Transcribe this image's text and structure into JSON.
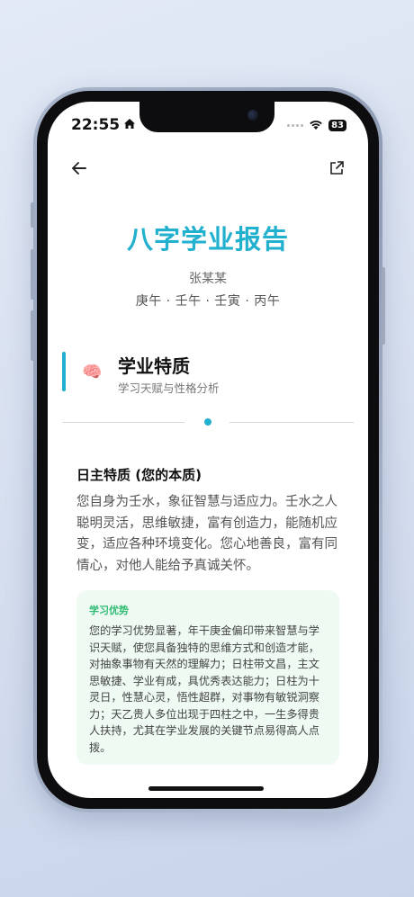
{
  "status": {
    "time": "22:55",
    "battery": "83"
  },
  "report": {
    "title": "八字学业报告",
    "name": "张某某",
    "pillars": "庚午 · 壬午 · 壬寅 · 丙午"
  },
  "section": {
    "title": "学业特质",
    "subtitle": "学习天赋与性格分析",
    "icon": "brain-icon"
  },
  "day_master": {
    "heading": "日主特质 (您的本质)",
    "text": "您自身为壬水，象征智慧与适应力。壬水之人聪明灵活，思维敏捷，富有创造力，能随机应变，适应各种环境变化。您心地善良，富有同情心，对他人能给予真诚关怀。"
  },
  "advantage": {
    "title": "学习优势",
    "text": "您的学习优势显著，年干庚金偏印带来智慧与学识天赋，使您具备独特的思维方式和创造才能，对抽象事物有天然的理解力；日柱带文昌，主文思敏捷、学业有成，具优秀表达能力；日柱为十灵日，性慧心灵，悟性超群，对事物有敏锐洞察力；天乙贵人多位出现于四柱之中，一生多得贵人扶持，尤其在学业发展的关键节点易得高人点拨。"
  },
  "colors": {
    "accent": "#22b0cf",
    "green": "#2fbb72",
    "card_bg": "#eefaf2"
  }
}
